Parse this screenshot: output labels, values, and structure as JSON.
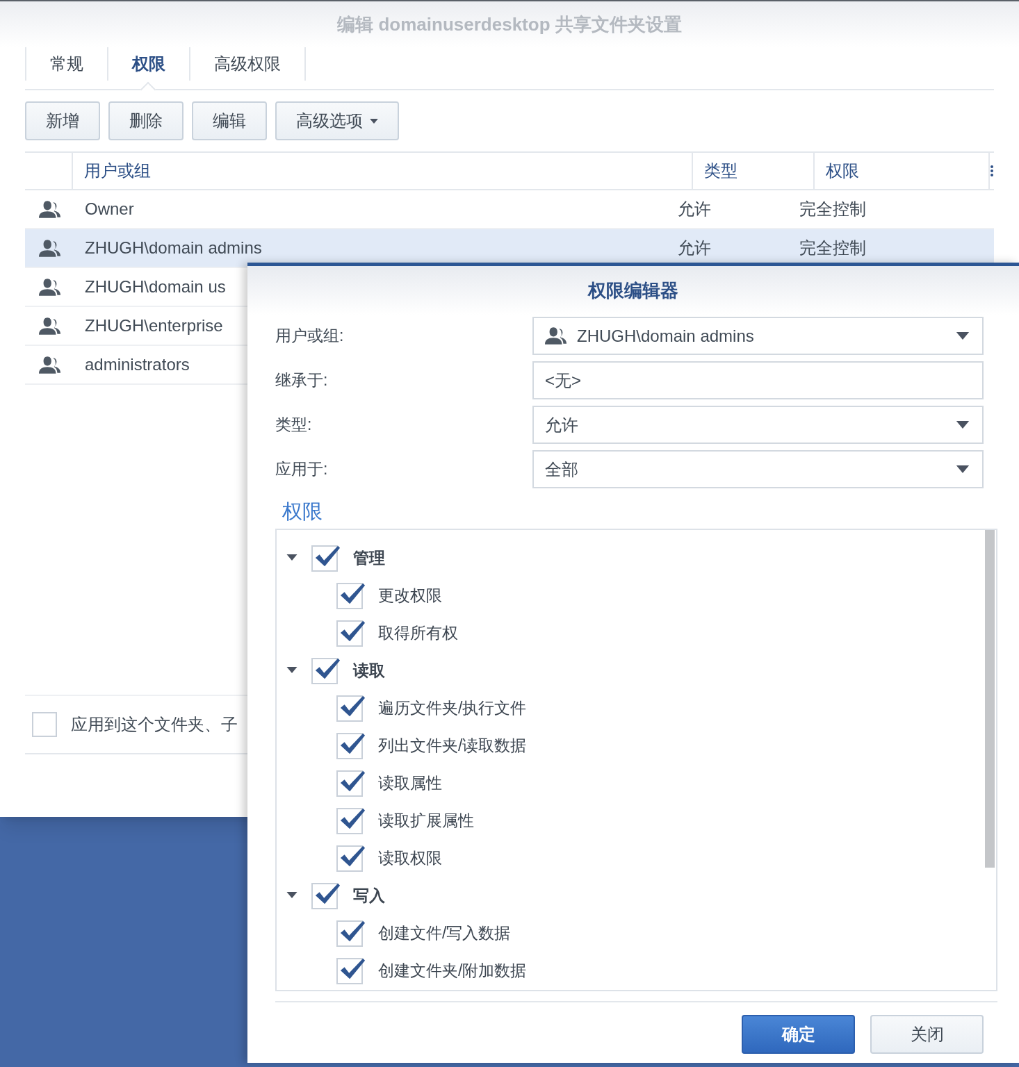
{
  "window": {
    "title": "编辑 domainuserdesktop 共享文件夹设置"
  },
  "tabs": [
    {
      "label": "常规",
      "selected": false
    },
    {
      "label": "权限",
      "selected": true
    },
    {
      "label": "高级权限",
      "selected": false
    }
  ],
  "toolbar": [
    {
      "label": "新增",
      "dropdown": false
    },
    {
      "label": "删除",
      "dropdown": false
    },
    {
      "label": "编辑",
      "dropdown": false
    },
    {
      "label": "高级选项",
      "dropdown": true
    }
  ],
  "table": {
    "columns": [
      "用户或组",
      "类型",
      "权限"
    ],
    "rows": [
      {
        "name": "Owner",
        "type": "允许",
        "permission": "完全控制",
        "selected": false
      },
      {
        "name": "ZHUGH\\domain admins",
        "type": "允许",
        "permission": "完全控制",
        "selected": true
      },
      {
        "name": "ZHUGH\\domain us",
        "selected": false
      },
      {
        "name": "ZHUGH\\enterprise",
        "selected": false
      },
      {
        "name": "administrators",
        "selected": false
      }
    ]
  },
  "apply_option": {
    "label": "应用到这个文件夹、子",
    "checked": false
  },
  "dialog": {
    "title": "权限编辑器",
    "fields": [
      {
        "label": "用户或组:",
        "value": "ZHUGH\\domain admins",
        "kind": "user-select"
      },
      {
        "label": "继承于:",
        "value": "<无>",
        "kind": "text"
      },
      {
        "label": "类型:",
        "value": "允许",
        "kind": "select"
      },
      {
        "label": "应用于:",
        "value": "全部",
        "kind": "select"
      }
    ],
    "section": "权限",
    "permissions": [
      {
        "label": "管理",
        "checked": true,
        "expanded": true,
        "children": [
          {
            "label": "更改权限",
            "checked": true
          },
          {
            "label": "取得所有权",
            "checked": true
          }
        ]
      },
      {
        "label": "读取",
        "checked": true,
        "expanded": true,
        "children": [
          {
            "label": "遍历文件夹/执行文件",
            "checked": true
          },
          {
            "label": "列出文件夹/读取数据",
            "checked": true
          },
          {
            "label": "读取属性",
            "checked": true
          },
          {
            "label": "读取扩展属性",
            "checked": true
          },
          {
            "label": "读取权限",
            "checked": true
          }
        ]
      },
      {
        "label": "写入",
        "checked": true,
        "expanded": true,
        "children": [
          {
            "label": "创建文件/写入数据",
            "checked": true
          },
          {
            "label": "创建文件夹/附加数据",
            "checked": true
          }
        ]
      }
    ],
    "buttons": [
      {
        "label": "确定",
        "primary": true
      },
      {
        "label": "关闭",
        "primary": false
      }
    ]
  }
}
